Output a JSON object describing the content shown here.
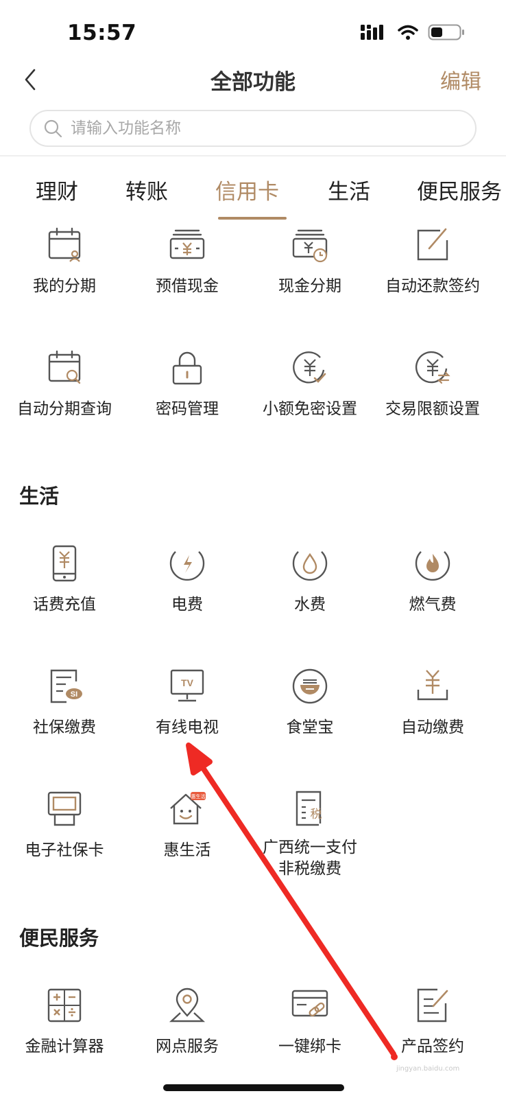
{
  "status_bar": {
    "time": "15:57"
  },
  "nav": {
    "title": "全部功能",
    "edit_label": "编辑"
  },
  "search": {
    "placeholder": "请输入功能名称"
  },
  "tabs": [
    {
      "label": "理财"
    },
    {
      "label": "转账"
    },
    {
      "label": "信用卡"
    },
    {
      "label": "生活"
    },
    {
      "label": "便民服务"
    }
  ],
  "credit_card_items": [
    {
      "label": "我的分期",
      "icon": "calendar-user-icon"
    },
    {
      "label": "预借现金",
      "icon": "cash-yen-icon"
    },
    {
      "label": "现金分期",
      "icon": "cash-clock-icon"
    },
    {
      "label": "自动还款签约",
      "icon": "edit-square-icon"
    },
    {
      "label": "自动分期查询",
      "icon": "calendar-search-icon"
    },
    {
      "label": "密码管理",
      "icon": "lock-icon"
    },
    {
      "label": "小额免密设置",
      "icon": "yen-check-icon"
    },
    {
      "label": "交易限额设置",
      "icon": "yen-swap-icon"
    }
  ],
  "life_section": {
    "title": "生活",
    "items": [
      {
        "label": "话费充值",
        "icon": "phone-yen-icon"
      },
      {
        "label": "电费",
        "icon": "lightning-icon"
      },
      {
        "label": "水费",
        "icon": "water-drop-icon"
      },
      {
        "label": "燃气费",
        "icon": "flame-icon"
      },
      {
        "label": "社保缴费",
        "icon": "social-security-icon"
      },
      {
        "label": "有线电视",
        "icon": "tv-icon"
      },
      {
        "label": "食堂宝",
        "icon": "bowl-icon"
      },
      {
        "label": "自动缴费",
        "icon": "auto-pay-icon"
      },
      {
        "label": "电子社保卡",
        "icon": "card-reader-icon"
      },
      {
        "label": "惠生活",
        "icon": "smile-house-icon",
        "badge": "惠生活"
      },
      {
        "label": "广西统一支付",
        "label2": "非税缴费",
        "icon": "tax-doc-icon"
      }
    ]
  },
  "service_section": {
    "title": "便民服务",
    "items": [
      {
        "label": "金融计算器",
        "icon": "calculator-icon"
      },
      {
        "label": "网点服务",
        "icon": "location-pin-icon"
      },
      {
        "label": "一键绑卡",
        "icon": "card-link-icon"
      },
      {
        "label": "产品签约",
        "icon": "sign-doc-icon"
      }
    ]
  },
  "watermark": "jingyan.baidu.com",
  "colors": {
    "accent": "#b08a64",
    "icon_stroke": "#555555",
    "annotation_arrow": "#ee2a24"
  }
}
